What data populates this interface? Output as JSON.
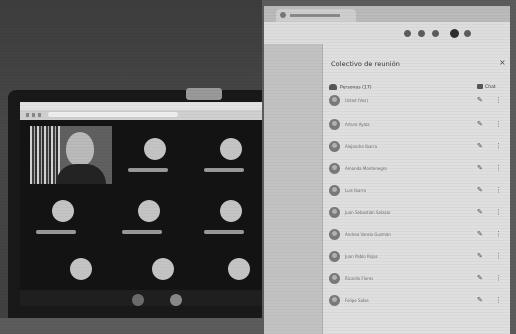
{
  "photo": {
    "monitor": {
      "panel_title": "Colectivo de reunión",
      "section_header": "Personas (17)",
      "chat_label": "Chat",
      "participants": [
        {
          "name": "Usted (Vos)"
        },
        {
          "name": "Arturo Ayala"
        },
        {
          "name": "Alejandro Ibarra"
        },
        {
          "name": "Amanda Montenegro"
        },
        {
          "name": "Luis Ibarra"
        },
        {
          "name": "Juan Sebastián Salazar"
        },
        {
          "name": "Andrea Varela Guzmán"
        },
        {
          "name": "Juan Pablo Rojas"
        },
        {
          "name": "Ricardo Flores"
        },
        {
          "name": "Felipe Salas"
        }
      ]
    },
    "icons": {
      "mic": "mic-icon",
      "more": "more-vert-icon",
      "close": "close-icon",
      "people": "people-icon",
      "chat": "chat-icon"
    }
  }
}
